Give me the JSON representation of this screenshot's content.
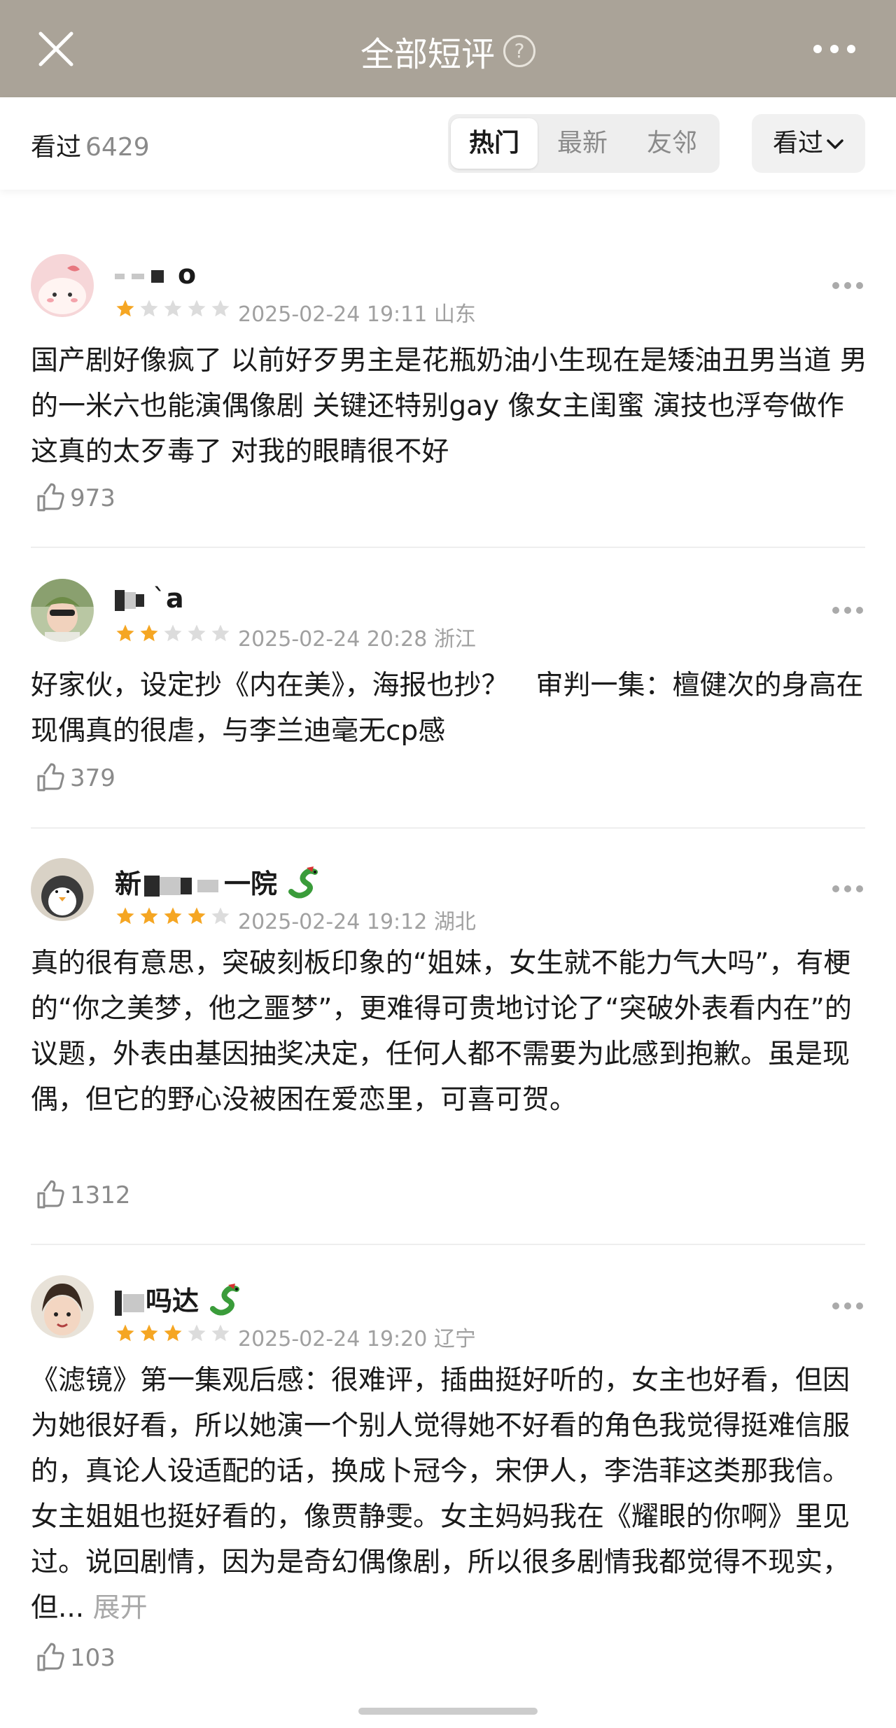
{
  "header": {
    "title": "全部短评",
    "help_glyph": "?"
  },
  "subbar": {
    "seen_label": "看过",
    "seen_count": "6429",
    "tabs": [
      "热门",
      "最新",
      "友邻"
    ],
    "active_tab": "热门",
    "filter_label": "看过"
  },
  "colors": {
    "topbar": "#aaa398",
    "star_on": "#f5a623",
    "star_off": "#dcdcdc"
  },
  "reviews": [
    {
      "username": "o",
      "rating": 1,
      "date": "2025-02-24 19:11",
      "region": "山东",
      "text": "国产剧好像疯了 以前好歹男主是花瓶奶油小生现在是矮油丑男当道 男的一米六也能演偶像剧 关键还特别gay 像女主闺蜜 演技也浮夸做作 这真的太歹毒了 对我的眼睛很不好",
      "likes": "973"
    },
    {
      "username": "a",
      "rating": 2,
      "date": "2025-02-24 20:28",
      "region": "浙江",
      "text": "好家伙，设定抄《内在美》，海报也抄？　审判一集：檀健次的身高在现偶真的很虐，与李兰迪毫无cp感",
      "likes": "379"
    },
    {
      "username": "新",
      "username_tail": "一院",
      "rating": 4,
      "date": "2025-02-24 19:12",
      "region": "湖北",
      "text": "真的很有意思，突破刻板印象的“姐妹，女生就不能力气大吗”，有梗的“你之美梦，他之噩梦”，更难得可贵地讨论了“突破外表看内在”的议题，外表由基因抽奖决定，任何人都不需要为此感到抱歉。虽是现偶，但它的野心没被困在爱恋里，可喜可贺。",
      "likes": "1312"
    },
    {
      "username": "",
      "rating": 3,
      "date": "2025-02-24 19:20",
      "region": "辽宁",
      "text": "《滤镜》第一集观后感：很难评，插曲挺好听的，女主也好看，但因为她很好看，所以她演一个别人觉得她不好看的角色我觉得挺难信服的，真论人设适配的话，换成卜冠今，宋伊人，李浩菲这类那我信。女主姐姐也挺好看的，像贾静雯。女主妈妈我在《耀眼的你啊》里见过。说回剧情，因为是奇幻偶像剧，所以很多剧情我都觉得不现实，但...",
      "expand_label": "展开",
      "likes": "103"
    }
  ]
}
